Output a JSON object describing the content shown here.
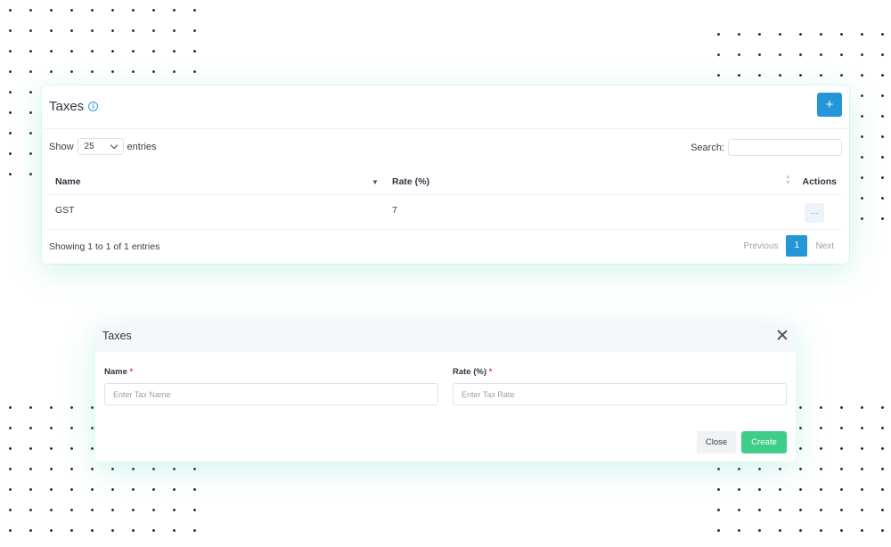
{
  "colors": {
    "primary": "#2496d8",
    "create": "#3fce8a",
    "required": "#e0454d"
  },
  "card": {
    "title": "Taxes",
    "add_label": "+",
    "show_label": "Show",
    "entries_value": "25",
    "entries_label": "entries",
    "search_label": "Search:",
    "search_value": "",
    "columns": {
      "name": "Name",
      "rate": "Rate (%)",
      "actions": "Actions"
    },
    "rows": [
      {
        "name": "GST",
        "rate": "7",
        "action_label": "···"
      }
    ],
    "showing": "Showing 1 to 1 of 1 entries",
    "pager": {
      "previous": "Previous",
      "page": "1",
      "next": "Next"
    }
  },
  "modal": {
    "title": "Taxes",
    "name_label": "Name",
    "name_placeholder": "Enter Tax Name",
    "rate_label": "Rate (%)",
    "rate_placeholder": "Enter Tax Rate",
    "required_mark": "*",
    "close_label": "Close",
    "create_label": "Create"
  }
}
